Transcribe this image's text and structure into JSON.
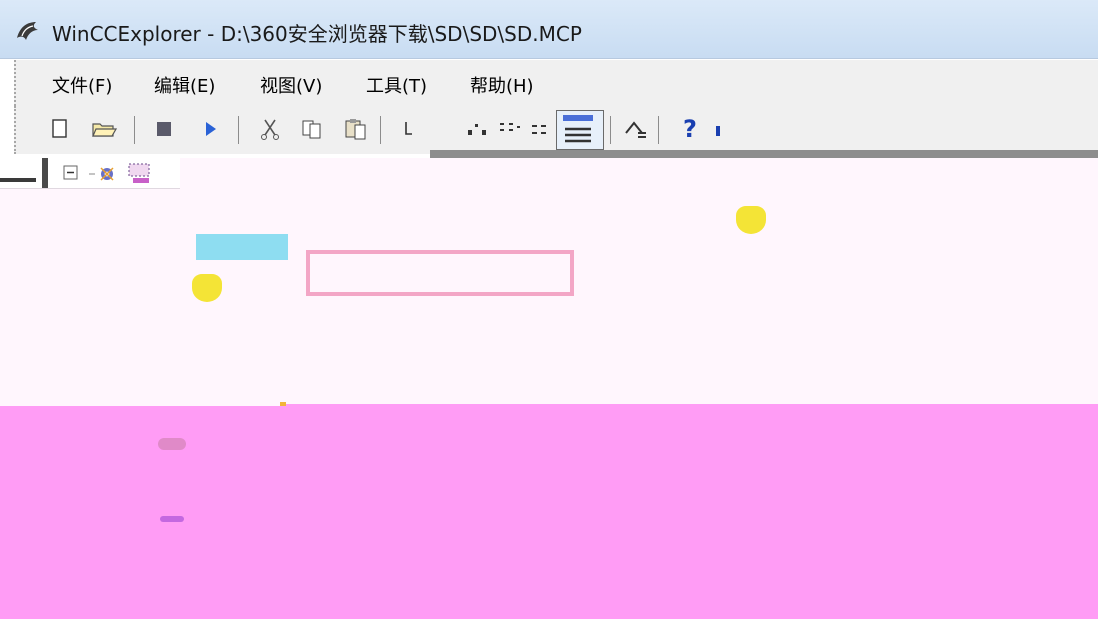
{
  "window": {
    "title": "WinCCExplorer - D:\\360安全浏览器下载\\SD\\SD\\SD.MCP",
    "icon": "wincc-explorer-app-icon"
  },
  "menu": {
    "items": [
      {
        "label": "文件(F)"
      },
      {
        "label": "编辑(E)"
      },
      {
        "label": "视图(V)"
      },
      {
        "label": "工具(T)"
      },
      {
        "label": "帮助(H)"
      }
    ]
  },
  "toolbar": {
    "buttons": [
      {
        "icon": "new-document-icon"
      },
      {
        "icon": "open-folder-icon"
      },
      {
        "icon": "stop-runtime-icon"
      },
      {
        "icon": "start-runtime-icon"
      },
      {
        "icon": "cut-icon"
      },
      {
        "icon": "copy-icon"
      },
      {
        "icon": "paste-icon"
      },
      {
        "icon": "properties-icon"
      },
      {
        "icon": "large-icons-view-icon"
      },
      {
        "icon": "small-icons-view-icon"
      },
      {
        "icon": "list-view-icon"
      },
      {
        "icon": "details-view-icon"
      },
      {
        "icon": "up-one-level-icon"
      },
      {
        "icon": "help-icon"
      }
    ],
    "help_label": "?"
  },
  "colors": {
    "titlebar": "#c8dcf2",
    "workspace": "#fff6fd",
    "magenta_artifact": "#ff9cf5",
    "cyan_highlight": "#7ad8ef",
    "pink_border": "#f3a6c6",
    "yellow_blob": "#f4e436"
  }
}
